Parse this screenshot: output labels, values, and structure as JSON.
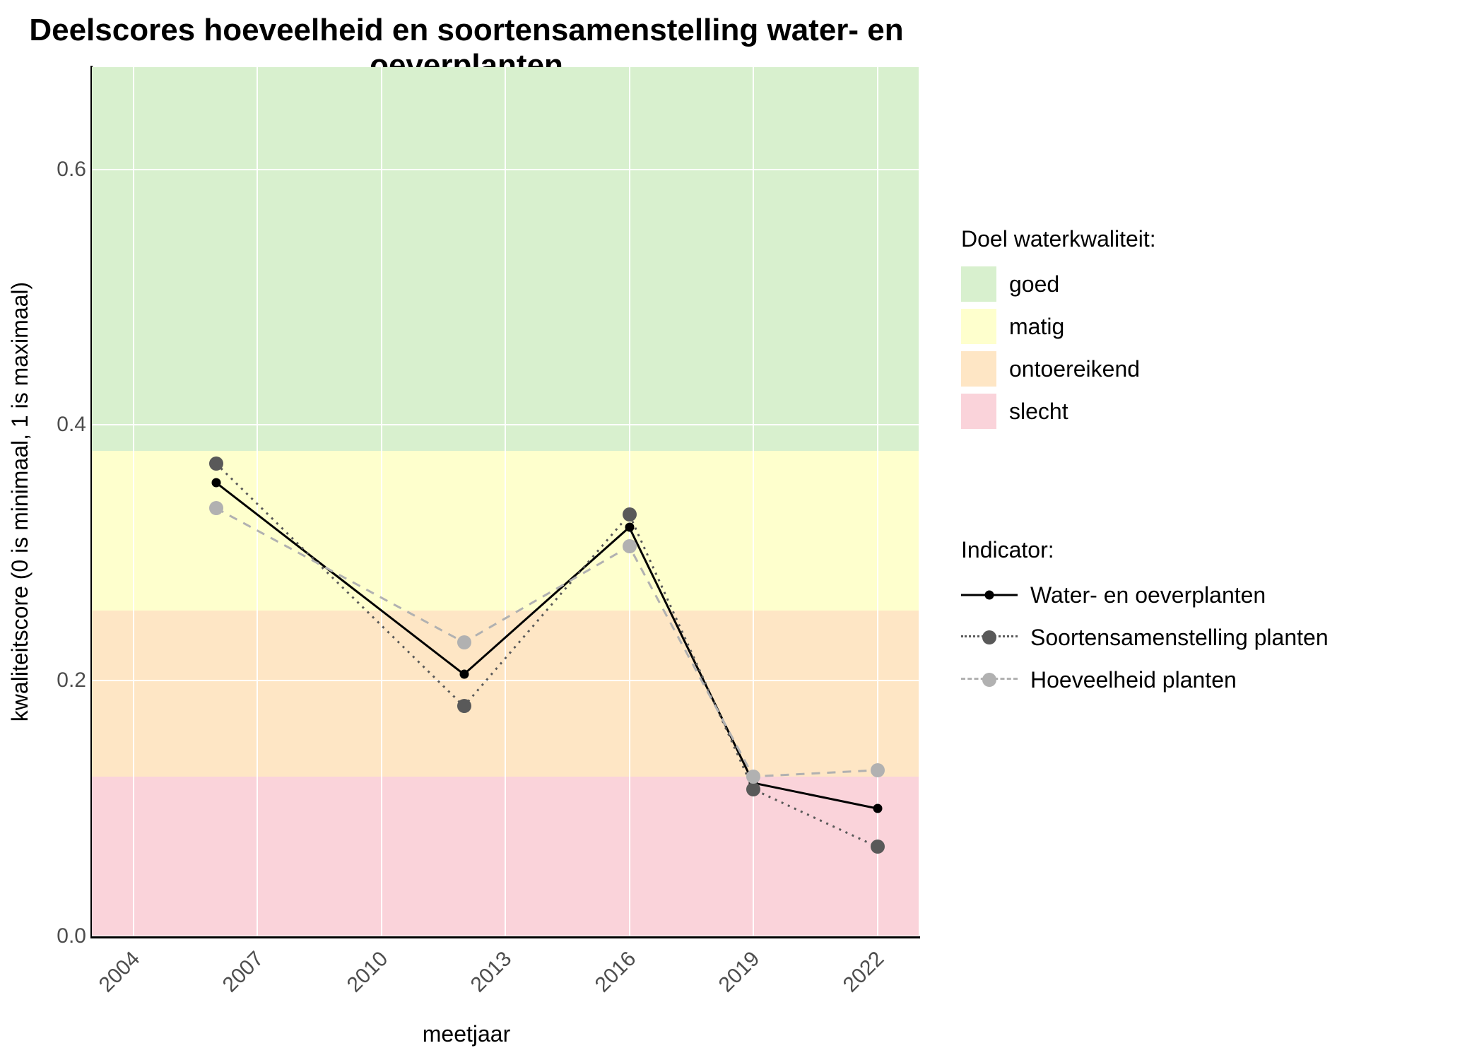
{
  "title": "Deelscores hoeveelheid en soortensamenstelling water- en oeverplanten",
  "xlabel": "meetjaar",
  "ylabel": "kwaliteitscore (0 is minimaal, 1 is maximaal)",
  "legend_quality_title": "Doel waterkwaliteit:",
  "legend_indicator_title": "Indicator:",
  "quality_levels": {
    "goed": {
      "label": "goed",
      "color": "#d8f0ce"
    },
    "matig": {
      "label": "matig",
      "color": "#feffcd"
    },
    "ontoereikend": {
      "label": "ontoereikend",
      "color": "#fee6c5"
    },
    "slecht": {
      "label": "slecht",
      "color": "#fad3da"
    }
  },
  "y_ticks": [
    "0.0",
    "0.2",
    "0.4",
    "0.6"
  ],
  "x_ticks": [
    "2004",
    "2007",
    "2010",
    "2013",
    "2016",
    "2019",
    "2022"
  ],
  "indicators": {
    "water_oever": {
      "label": "Water- en oeverplanten",
      "color": "#000000",
      "point_size": 13
    },
    "soorten": {
      "label": "Soortensamenstelling planten",
      "color": "#595959",
      "point_size": 20
    },
    "hoeveelheid": {
      "label": "Hoeveelheid planten",
      "color": "#b1b1b1",
      "point_size": 20
    }
  },
  "chart_data": {
    "type": "line",
    "title": "Deelscores hoeveelheid en soortensamenstelling water- en oeverplanten",
    "xlabel": "meetjaar",
    "ylabel": "kwaliteitscore (0 is minimaal, 1 is maximaal)",
    "x_range": [
      2003,
      2023
    ],
    "y_range": [
      0.0,
      0.68
    ],
    "bands": [
      {
        "name": "slecht",
        "from": 0.0,
        "to": 0.125,
        "color": "#fad3da"
      },
      {
        "name": "ontoereikend",
        "from": 0.125,
        "to": 0.255,
        "color": "#fee6c5"
      },
      {
        "name": "matig",
        "from": 0.255,
        "to": 0.38,
        "color": "#feffcd"
      },
      {
        "name": "goed",
        "from": 0.38,
        "to": 0.68,
        "color": "#d8f0ce"
      }
    ],
    "x": [
      2006,
      2012,
      2016,
      2019,
      2022
    ],
    "series": [
      {
        "name": "Water- en oeverplanten",
        "dash": "solid",
        "color": "#000000",
        "point_size": 13,
        "values": [
          0.355,
          0.205,
          0.32,
          0.12,
          0.1
        ]
      },
      {
        "name": "Soortensamenstelling planten",
        "dash": "dotted",
        "color": "#595959",
        "point_size": 20,
        "values": [
          0.37,
          0.18,
          0.33,
          0.115,
          0.07
        ]
      },
      {
        "name": "Hoeveelheid planten",
        "dash": "dashed",
        "color": "#b1b1b1",
        "point_size": 20,
        "values": [
          0.335,
          0.23,
          0.305,
          0.125,
          0.13
        ]
      }
    ],
    "grid": true,
    "legend_positions": {
      "quality": "right-top",
      "indicator": "right-middle"
    }
  }
}
